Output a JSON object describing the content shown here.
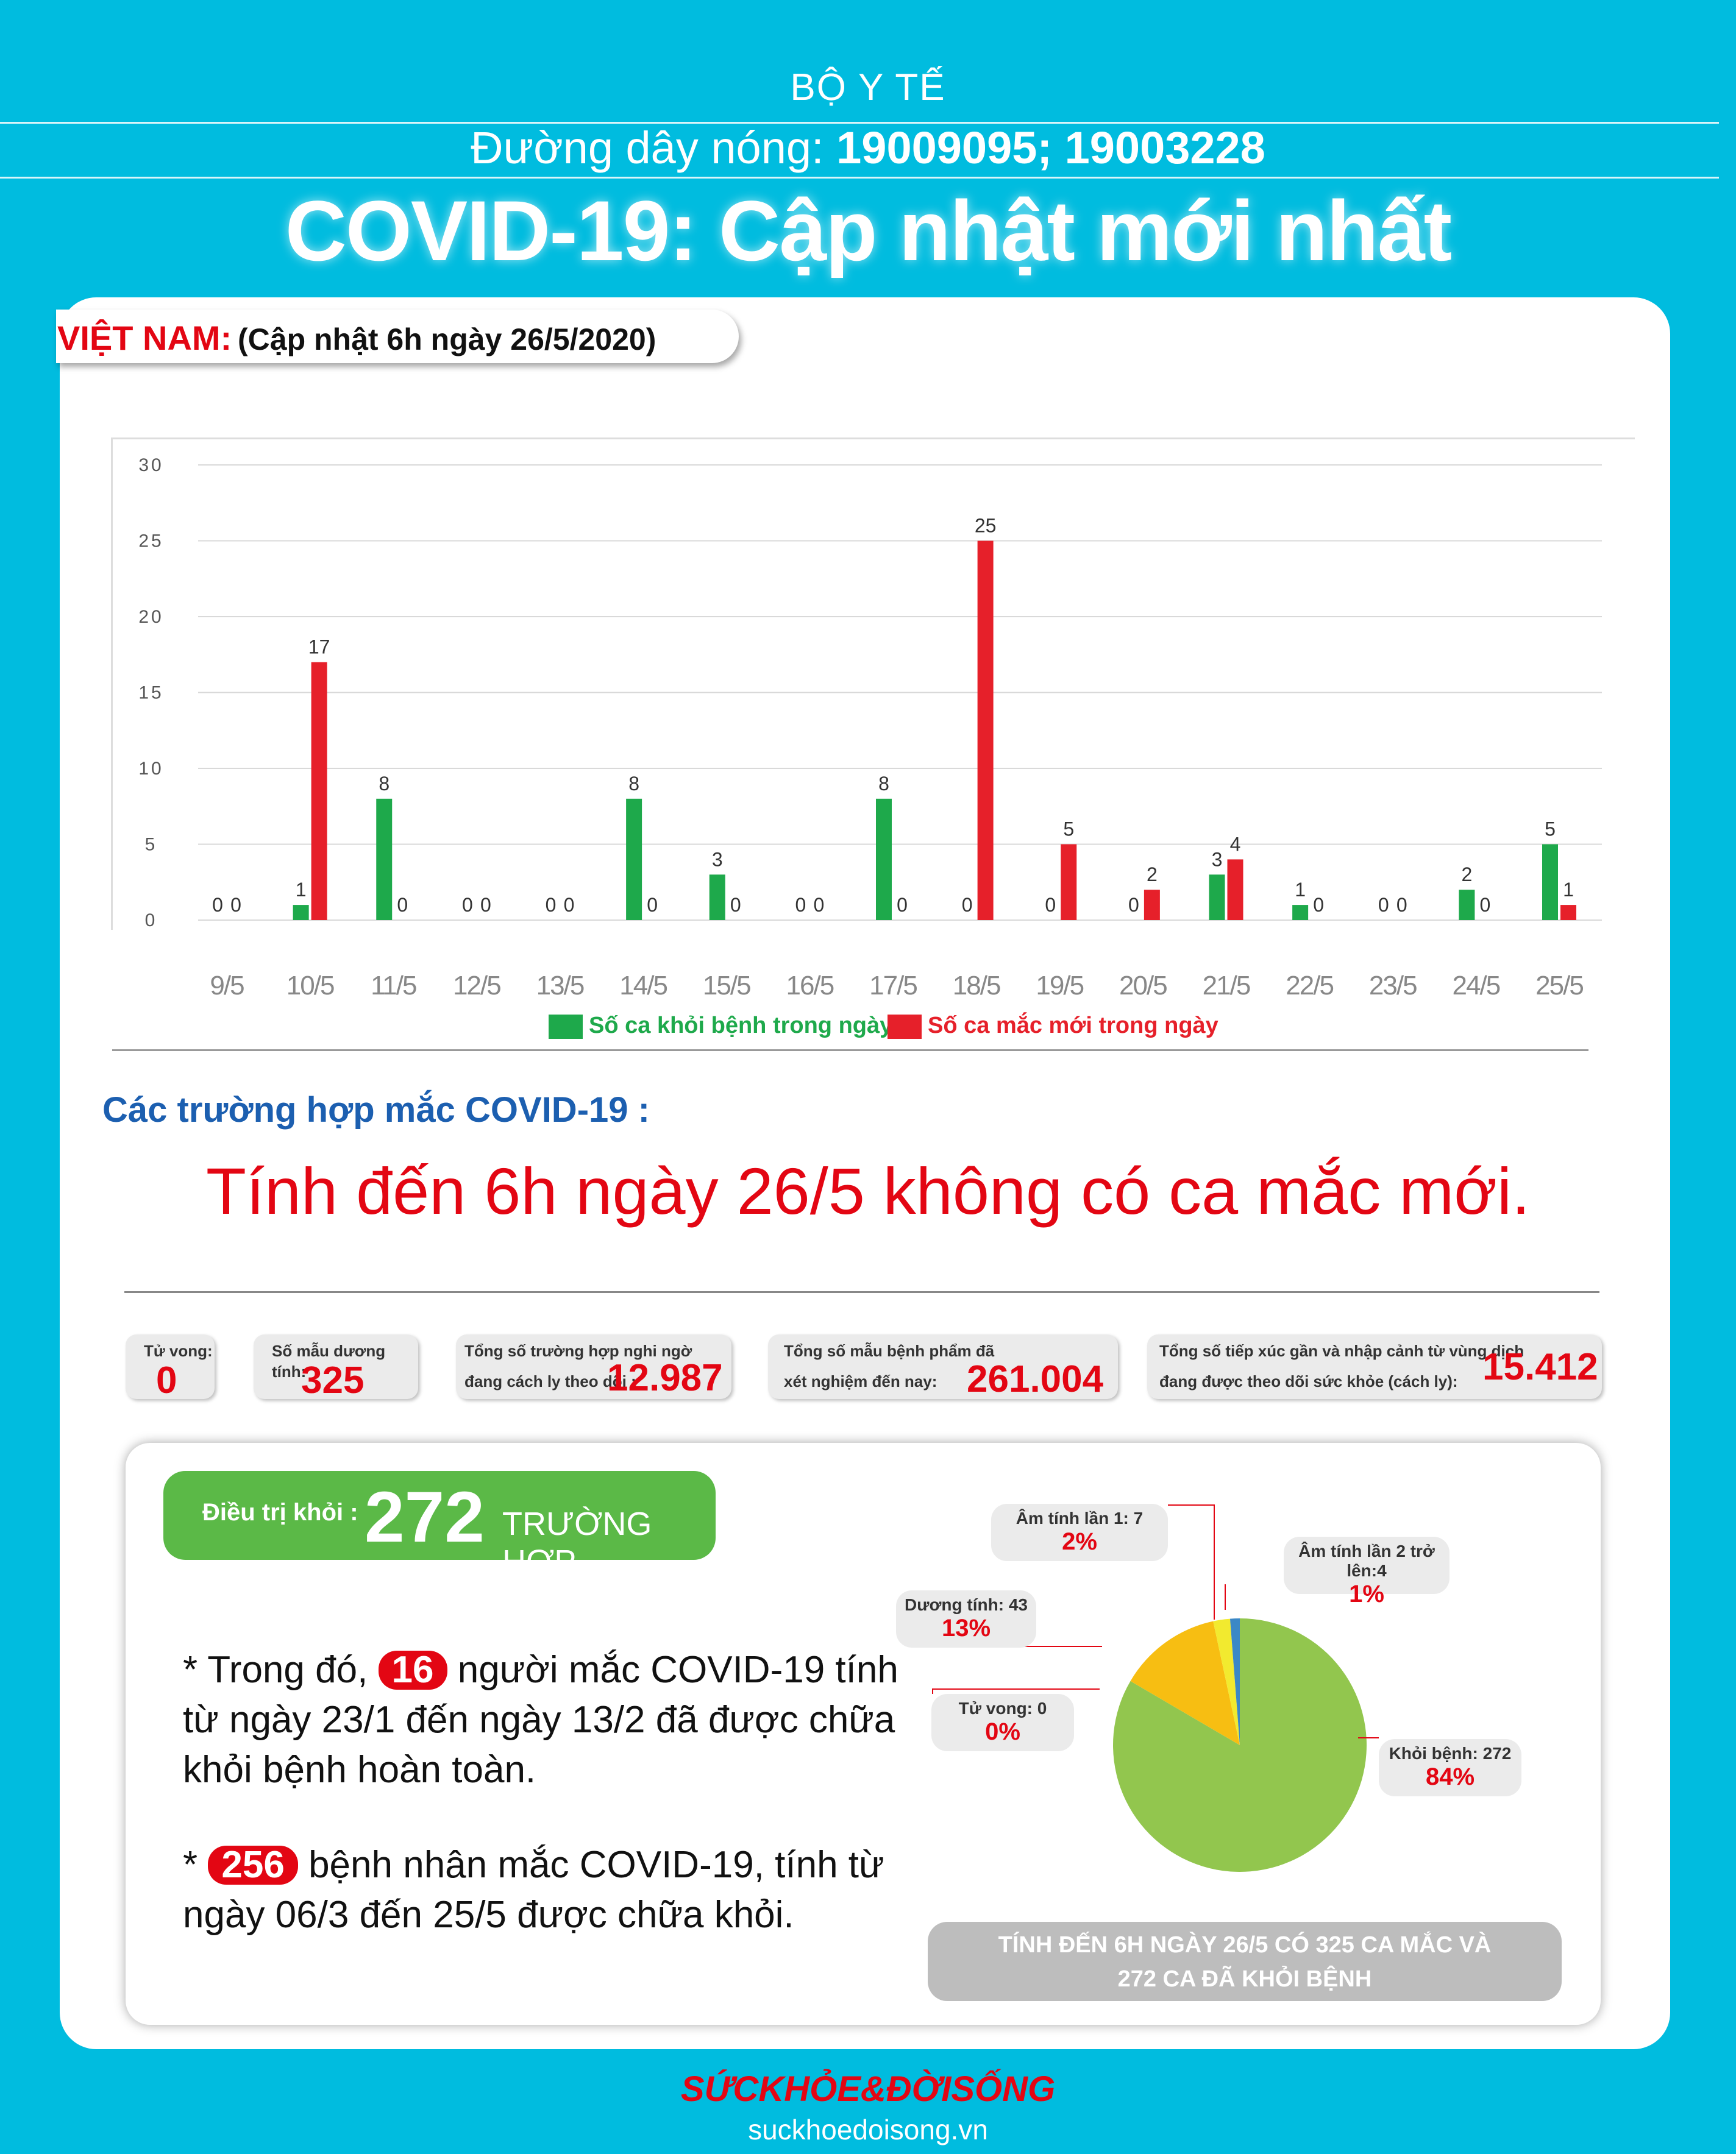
{
  "header": {
    "org": "BỘ Y TẾ",
    "hotline_label": "Đường dây nóng:",
    "hotline_numbers": "19009095; 19003228",
    "title": "COVID-19: Cập nhật mới nhất"
  },
  "vietnam_tab": {
    "country": "VIỆT NAM:",
    "update": "(Cập nhật 6h ngày 26/5/2020)"
  },
  "colors": {
    "recovered": "#1EA94B",
    "new_cases": "#E6202A",
    "accent_red": "#E30613",
    "bg_cyan": "#00BCDF"
  },
  "chart_data": {
    "type": "bar",
    "categories": [
      "9/5",
      "10/5",
      "11/5",
      "12/5",
      "13/5",
      "14/5",
      "15/5",
      "16/5",
      "17/5",
      "18/5",
      "19/5",
      "20/5",
      "21/5",
      "22/5",
      "23/5",
      "24/5",
      "25/5"
    ],
    "series": [
      {
        "name": "Số ca khỏi bệnh trong ngày",
        "values": [
          0,
          1,
          8,
          0,
          0,
          8,
          3,
          0,
          8,
          0,
          0,
          0,
          3,
          1,
          0,
          2,
          5
        ]
      },
      {
        "name": "Số ca mắc mới  trong ngày",
        "values": [
          0,
          17,
          0,
          0,
          0,
          0,
          0,
          0,
          0,
          25,
          5,
          2,
          4,
          0,
          0,
          0,
          1
        ]
      }
    ],
    "yticks": [
      0,
      5,
      10,
      15,
      20,
      25,
      30
    ],
    "ylim": [
      0,
      30
    ],
    "grid": true,
    "legend": "bottom-center"
  },
  "cases_heading": "Các trường hợp mắc COVID-19 :",
  "no_new_cases": "Tính đến 6h ngày 26/5 không có ca mắc mới.",
  "stats": {
    "deaths_label": "Tử vong:",
    "deaths_value": "0",
    "positive_label": "Số mẫu dương tính:",
    "positive_value": "325",
    "suspected_label_1": "Tổng số trường hợp nghi ngờ",
    "suspected_label_2": "đang cách ly theo dõi :",
    "suspected_value": "12.987",
    "tested_label_1": "Tổng số mẫu bệnh phẩm đã",
    "tested_label_2": "xét nghiệm đến nay:",
    "tested_value": "261.004",
    "contacts_label_1": "Tổng số tiếp xúc gần và nhập cảnh từ vùng dịch",
    "contacts_label_2": "đang được theo dõi sức khỏe (cách ly):",
    "contacts_value": "15.412"
  },
  "treated": {
    "label": "Điều trị khỏi :",
    "number": "272",
    "unit": "TRƯỜNG HỢP"
  },
  "notes": {
    "n1_prefix": "* Trong đó,",
    "n1_pill": "16",
    "n1_text_a": "người mắc COVID-19 tính",
    "n1_text_b": "từ ngày 23/1 đến ngày 13/2 đã được chữa",
    "n1_text_c": "khỏi bệnh hoàn toàn.",
    "n2_prefix": "*",
    "n2_pill": "256",
    "n2_text_a": "bệnh nhân  mắc COVID-19, tính từ",
    "n2_text_b": "ngày 06/3 đến 25/5 được chữa khỏi."
  },
  "pie": {
    "slices": [
      {
        "name": "Khỏi bệnh: 272",
        "value": 272,
        "percent": "84%",
        "color": "#92C64E"
      },
      {
        "name": "Dương tính: 43",
        "value": 43,
        "percent": "13%",
        "color": "#F7BE12"
      },
      {
        "name": "Âm tính lần 1: 7",
        "value": 7,
        "percent": "2%",
        "color": "#F2EA2F"
      },
      {
        "name": "Âm tính lần 2 trở lên:4",
        "value": 4,
        "percent": "1%",
        "color": "#3B88C6"
      },
      {
        "name": "Tử vong: 0",
        "value": 0,
        "percent": "0%",
        "color": "#555555"
      }
    ]
  },
  "summary_1": "TÍNH ĐẾN 6H NGÀY 26/5 CÓ 325 CA MẮC VÀ",
  "summary_2": "272 CA ĐÃ KHỎI BỆNH",
  "footer": {
    "brand": "SỨCKHỎE&ĐỜISỐNG",
    "site": "suckhoedoisong.vn"
  }
}
